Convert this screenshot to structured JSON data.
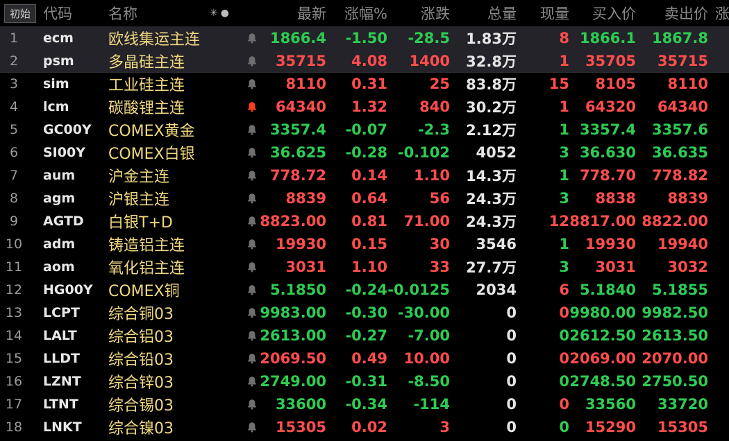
{
  "header": {
    "init_button": "初始",
    "columns": {
      "code": "代码",
      "name": "名称",
      "last": "最新",
      "pct": "涨幅%",
      "chg": "涨跌",
      "vol": "总量",
      "cur": "现量",
      "bid": "买入价",
      "ask": "卖出价",
      "clip": "涨"
    },
    "icon_asterisk": "✳",
    "icon_dot": "●"
  },
  "colors": {
    "up": "#ff4d4d",
    "down": "#2ecc52",
    "bell": "#6f6f6f",
    "bell_active": "#ff3b1f",
    "name": "#f0d880"
  },
  "rows": [
    {
      "idx": "1",
      "code": "ecm",
      "name": "欧线集运主连",
      "dir": "down",
      "last": "1866.4",
      "pct": "-1.50",
      "chg": "-28.5",
      "vol": "1.83万",
      "cur": "8",
      "cur_dir": "up",
      "bid": "1866.1",
      "ask": "1867.8",
      "bell": "normal",
      "selected": true
    },
    {
      "idx": "2",
      "code": "psm",
      "name": "多晶硅主连",
      "dir": "up",
      "last": "35715",
      "pct": "4.08",
      "chg": "1400",
      "vol": "32.8万",
      "cur": "1",
      "cur_dir": "up",
      "bid": "35705",
      "ask": "35715",
      "bell": "normal",
      "selected": true
    },
    {
      "idx": "3",
      "code": "sim",
      "name": "工业硅主连",
      "dir": "up",
      "last": "8110",
      "pct": "0.31",
      "chg": "25",
      "vol": "83.8万",
      "cur": "15",
      "cur_dir": "up",
      "bid": "8105",
      "ask": "8110",
      "bell": "normal"
    },
    {
      "idx": "4",
      "code": "lcm",
      "name": "碳酸锂主连",
      "dir": "up",
      "last": "64340",
      "pct": "1.32",
      "chg": "840",
      "vol": "30.2万",
      "cur": "1",
      "cur_dir": "up",
      "bid": "64320",
      "ask": "64340",
      "bell": "active"
    },
    {
      "idx": "5",
      "code": "GC00Y",
      "name": "COMEX黄金",
      "dir": "down",
      "last": "3357.4",
      "pct": "-0.07",
      "chg": "-2.3",
      "vol": "2.12万",
      "cur": "1",
      "cur_dir": "down",
      "bid": "3357.4",
      "ask": "3357.6",
      "bell": "normal"
    },
    {
      "idx": "6",
      "code": "SI00Y",
      "name": "COMEX白银",
      "dir": "down",
      "last": "36.625",
      "pct": "-0.28",
      "chg": "-0.102",
      "vol": "4052",
      "cur": "3",
      "cur_dir": "down",
      "bid": "36.630",
      "ask": "36.635",
      "bell": "normal"
    },
    {
      "idx": "7",
      "code": "aum",
      "name": "沪金主连",
      "dir": "up",
      "last": "778.72",
      "pct": "0.14",
      "chg": "1.10",
      "vol": "14.3万",
      "cur": "1",
      "cur_dir": "down",
      "bid": "778.70",
      "ask": "778.82",
      "bell": "normal"
    },
    {
      "idx": "8",
      "code": "agm",
      "name": "沪银主连",
      "dir": "up",
      "last": "8839",
      "pct": "0.64",
      "chg": "56",
      "vol": "24.3万",
      "cur": "3",
      "cur_dir": "down",
      "bid": "8838",
      "ask": "8839",
      "bell": "normal"
    },
    {
      "idx": "9",
      "code": "AGTD",
      "name": "白银T+D",
      "dir": "up",
      "last": "8823.00",
      "pct": "0.81",
      "chg": "71.00",
      "vol": "24.3万",
      "cur": "12",
      "cur_dir": "up",
      "bid": "8817.00",
      "ask": "8822.00",
      "bell": "normal"
    },
    {
      "idx": "10",
      "code": "adm",
      "name": "铸造铝主连",
      "dir": "up",
      "last": "19930",
      "pct": "0.15",
      "chg": "30",
      "vol": "3546",
      "cur": "1",
      "cur_dir": "down",
      "bid": "19930",
      "ask": "19940",
      "bell": "normal"
    },
    {
      "idx": "11",
      "code": "aom",
      "name": "氧化铝主连",
      "dir": "up",
      "last": "3031",
      "pct": "1.10",
      "chg": "33",
      "vol": "27.7万",
      "cur": "3",
      "cur_dir": "down",
      "bid": "3031",
      "ask": "3032",
      "bell": "normal"
    },
    {
      "idx": "12",
      "code": "HG00Y",
      "name": "COMEX铜",
      "dir": "down",
      "last": "5.1850",
      "pct": "-0.24",
      "chg": "-0.0125",
      "vol": "2034",
      "cur": "6",
      "cur_dir": "up",
      "bid": "5.1840",
      "ask": "5.1855",
      "bell": "normal"
    },
    {
      "idx": "13",
      "code": "LCPT",
      "name": "综合铜03",
      "dir": "down",
      "last": "9983.00",
      "pct": "-0.30",
      "chg": "-30.00",
      "vol": "0",
      "cur": "0",
      "cur_dir": "up",
      "bid": "9980.00",
      "ask": "9982.50",
      "bell": "normal"
    },
    {
      "idx": "14",
      "code": "LALT",
      "name": "综合铝03",
      "dir": "down",
      "last": "2613.00",
      "pct": "-0.27",
      "chg": "-7.00",
      "vol": "0",
      "cur": "0",
      "cur_dir": "down",
      "bid": "2612.50",
      "ask": "2613.50",
      "bell": "normal"
    },
    {
      "idx": "15",
      "code": "LLDT",
      "name": "综合铅03",
      "dir": "up",
      "last": "2069.50",
      "pct": "0.49",
      "chg": "10.00",
      "vol": "0",
      "cur": "0",
      "cur_dir": "up",
      "bid": "2069.00",
      "ask": "2070.00",
      "bell": "normal"
    },
    {
      "idx": "16",
      "code": "LZNT",
      "name": "综合锌03",
      "dir": "down",
      "last": "2749.00",
      "pct": "-0.31",
      "chg": "-8.50",
      "vol": "0",
      "cur": "0",
      "cur_dir": "down",
      "bid": "2748.50",
      "ask": "2750.50",
      "bell": "normal"
    },
    {
      "idx": "17",
      "code": "LTNT",
      "name": "综合锡03",
      "dir": "down",
      "last": "33600",
      "pct": "-0.34",
      "chg": "-114",
      "vol": "0",
      "cur": "0",
      "cur_dir": "up",
      "bid": "33560",
      "ask": "33720",
      "bell": "normal"
    },
    {
      "idx": "18",
      "code": "LNKT",
      "name": "综合镍03",
      "dir": "up",
      "last": "15305",
      "pct": "0.02",
      "chg": "3",
      "vol": "0",
      "cur": "0",
      "cur_dir": "down",
      "bid": "15290",
      "ask": "15305",
      "bell": "normal"
    }
  ]
}
